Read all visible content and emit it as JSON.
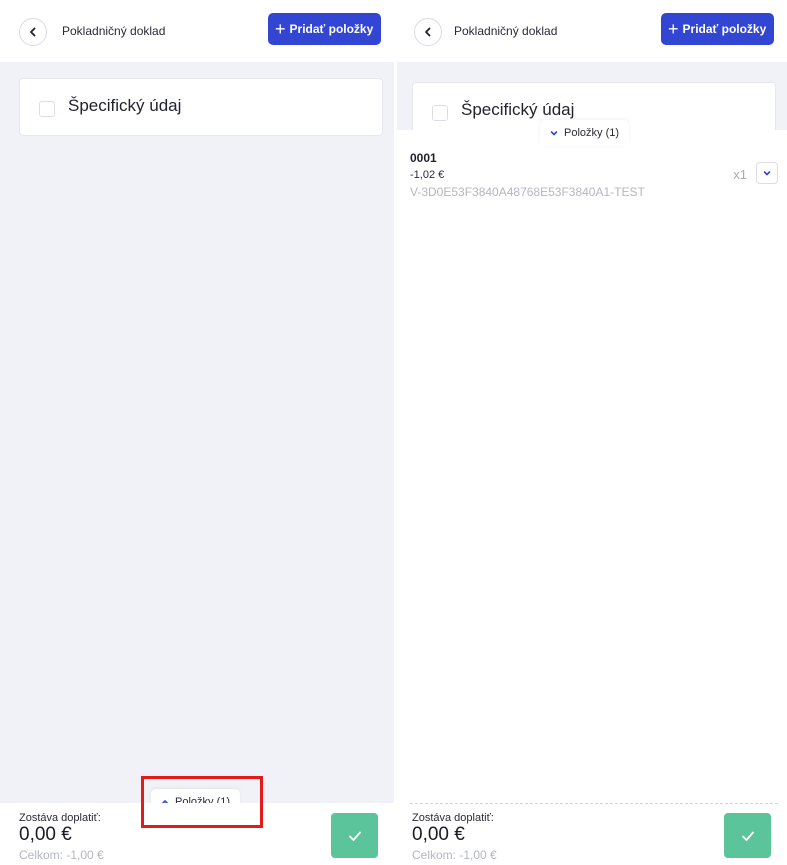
{
  "header": {
    "title": "Pokladničný doklad",
    "add_button_label": "Pridať položky"
  },
  "card": {
    "specific_label": "Špecifický údaj"
  },
  "items_tab": {
    "label": "Položky (1)"
  },
  "footer": {
    "remaining_label": "Zostáva doplatiť:",
    "remaining_amount": "0,00 €",
    "total_label": "Celkom: -1,00 €"
  },
  "items": [
    {
      "code": "0001",
      "price": "-1,02 €",
      "id": "V-3D0E53F3840A48768E53F3840A1-TEST",
      "quantity": "x1"
    }
  ],
  "icons": {
    "back": "chevron-left-icon",
    "add": "plus-icon",
    "expand_up": "chevron-up-icon",
    "expand_down": "chevron-down-icon",
    "confirm": "check-icon"
  },
  "colors": {
    "primary": "#3246d3",
    "confirm": "#5cc49a",
    "background": "#f1f2f7",
    "highlight": "#e21a1a"
  }
}
